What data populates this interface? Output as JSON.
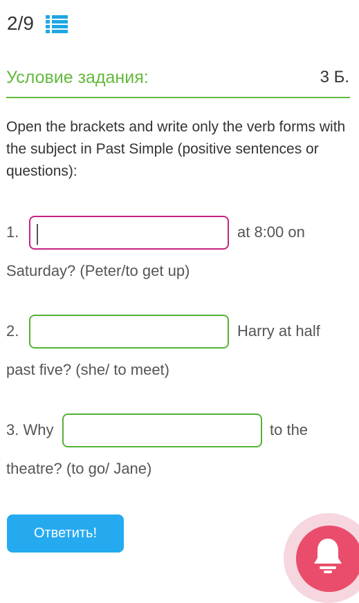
{
  "header": {
    "progress": "2/9",
    "list_icon": "list-icon"
  },
  "condition": {
    "title": "Условие задания:",
    "points": "3 Б."
  },
  "instruction": "Open the brackets and write only the verb forms with the subject in Past Simple (positive sentences or questions):",
  "questions": [
    {
      "prefix": "1.",
      "answer": "",
      "after": "at 8:00 on",
      "continuation": "Saturday? (Peter/to get up)",
      "focused": true
    },
    {
      "prefix": "2.",
      "answer": "",
      "after": "Harry at half",
      "continuation": "past five? (she/ to meet)",
      "focused": false
    },
    {
      "prefix": "3. Why",
      "answer": "",
      "after": "to the",
      "continuation": "theatre? (to go/ Jane)",
      "focused": false
    }
  ],
  "submit_label": "Ответить!",
  "notification_icon": "bell-icon",
  "colors": {
    "accent_green": "#62b83c",
    "active_border": "#c8217f",
    "input_border": "#53b233",
    "button_blue": "#25aaf0",
    "bell_red": "#ea4d6b"
  }
}
